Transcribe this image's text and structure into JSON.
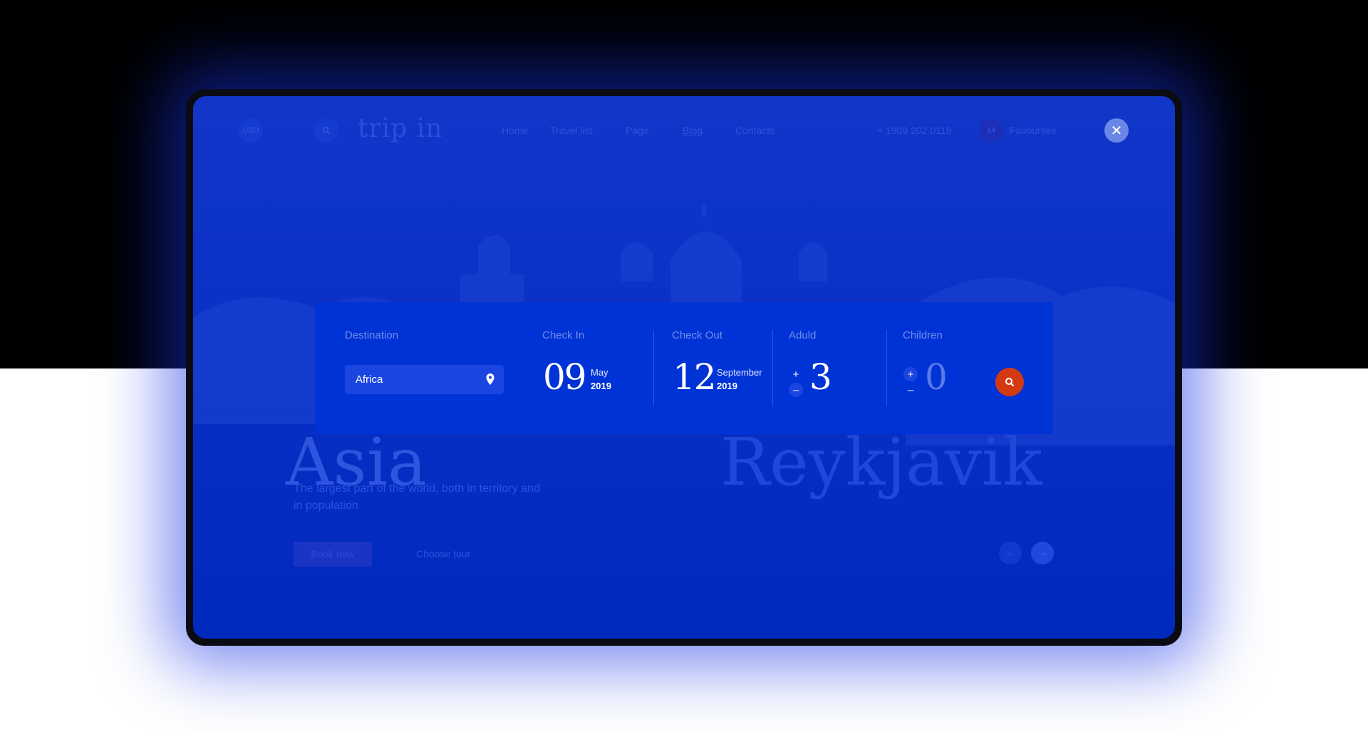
{
  "colors": {
    "accent": "#d43a12",
    "panel": "#0033d6",
    "screen": "#0a30c6"
  },
  "nav": {
    "currency": "USD",
    "logo": "trip in",
    "links": [
      "Home",
      "Travel list",
      "Page",
      "Blog",
      "Contacts"
    ],
    "phone": "+ 1909 202 0119",
    "fav_count": "14",
    "fav_label": "Favourites",
    "close_icon": "close-icon"
  },
  "hero": {
    "title": "Asia",
    "title2": "Reykjavik",
    "description_line1": "The largest part of the world, both in territory and",
    "description_line2": "in population",
    "book_label": "Book now",
    "choose_label": "Choose tour",
    "prev_icon": "arrow-left-icon",
    "next_icon": "arrow-right-icon"
  },
  "search": {
    "destination": {
      "label": "Destination",
      "value": "Africa",
      "icon": "map-pin-icon"
    },
    "check_in": {
      "label": "Check In",
      "day": "09",
      "month": "May",
      "year": "2019"
    },
    "check_out": {
      "label": "Check Out",
      "day": "12",
      "month": "September",
      "year": "2019"
    },
    "adults": {
      "label": "Aduld",
      "value": "3",
      "plus": "+",
      "minus": "–"
    },
    "children": {
      "label": "Children",
      "value": "0",
      "plus": "+",
      "minus": "–"
    },
    "submit_icon": "search-icon"
  }
}
